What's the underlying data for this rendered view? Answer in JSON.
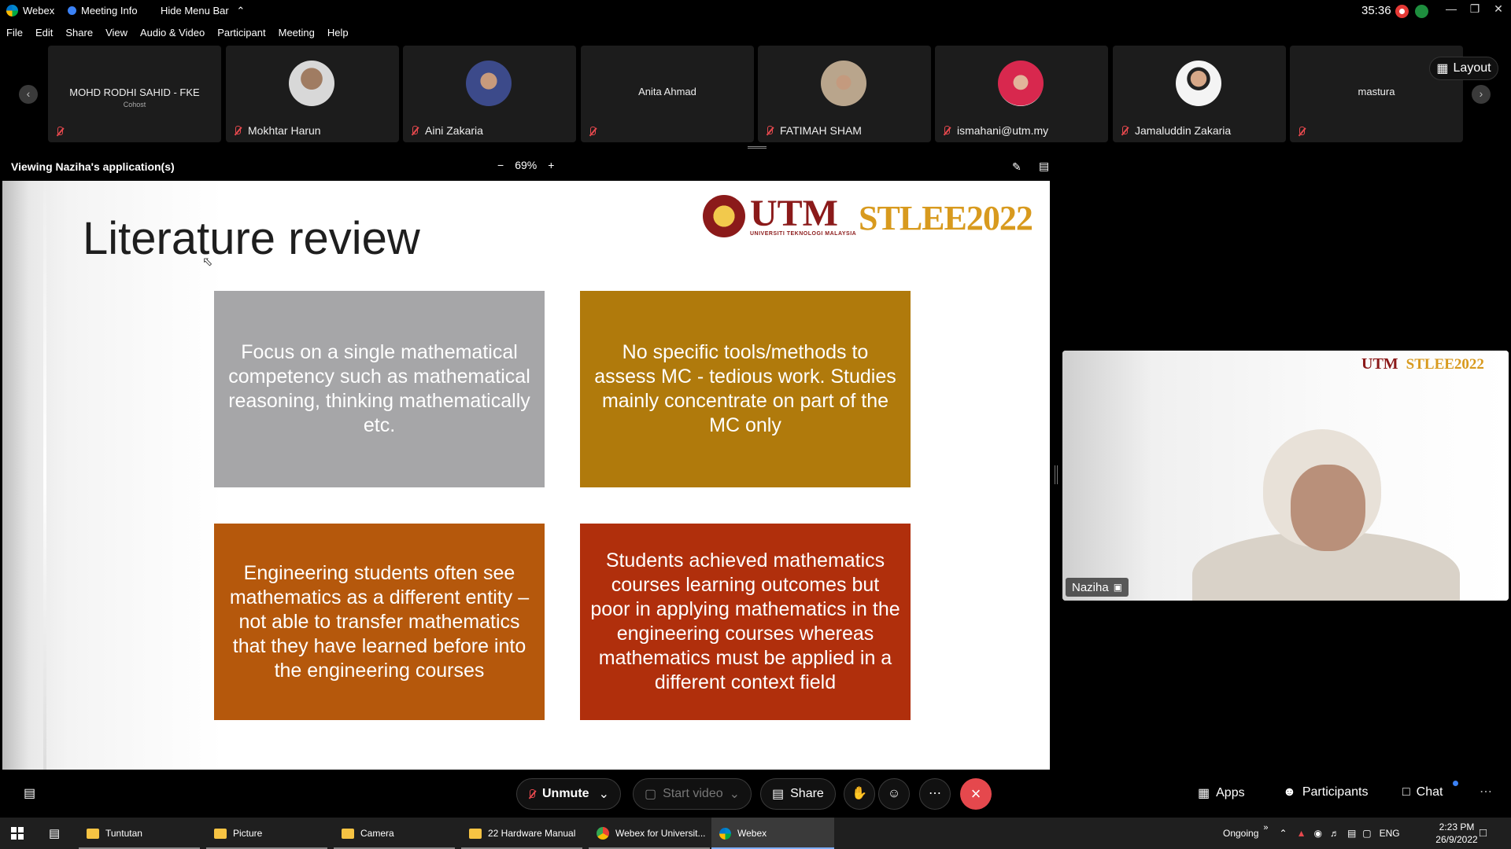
{
  "titlebar": {
    "app_name": "Webex",
    "meeting_info": "Meeting Info",
    "hide_menu": "Hide Menu Bar",
    "timer": "35:36"
  },
  "menu": [
    "File",
    "Edit",
    "Share",
    "View",
    "Audio & Video",
    "Participant",
    "Meeting",
    "Help"
  ],
  "participants": [
    {
      "name": "MOHD RODHI SAHID - FKE",
      "role": "Cohost"
    },
    {
      "name": "Mokhtar Harun"
    },
    {
      "name": "Aini Zakaria"
    },
    {
      "name": "Anita Ahmad"
    },
    {
      "name": "FATIMAH SHAM"
    },
    {
      "name": "ismahani@utm.my"
    },
    {
      "name": "Jamaluddin Zakaria"
    },
    {
      "name": "mastura"
    }
  ],
  "layout_label": "Layout",
  "share": {
    "viewing": "Viewing Naziha's application(s)",
    "zoom": "69%"
  },
  "slide": {
    "title": "Literature review",
    "utm": "UTM",
    "utm_sub": "UNIVERSITI TEKNOLOGI MALAYSIA",
    "conference": "STLEE2022",
    "boxes": [
      {
        "text": "Focus on a single mathematical competency such as mathematical reasoning, thinking mathematically etc.",
        "color": "#a6a6a8"
      },
      {
        "text": "No specific tools/methods to assess MC -  tedious work. Studies mainly concentrate on part of the MC only",
        "color": "#b07a0c"
      },
      {
        "text": "Engineering  students often see mathematics as a different entity – not able to transfer mathematics that they have learned before into the engineering courses",
        "color": "#b5580c"
      },
      {
        "text": "Students achieved mathematics courses learning outcomes but poor in applying mathematics in the engineering courses whereas mathematics must be applied in a different context field",
        "color": "#b02f0c"
      }
    ]
  },
  "self_video": {
    "name": "Naziha",
    "utm": "UTM",
    "conference": "STLEE2022"
  },
  "controls": {
    "unmute": "Unmute",
    "start_video": "Start video",
    "share": "Share",
    "apps": "Apps",
    "participants": "Participants",
    "chat": "Chat"
  },
  "taskbar": {
    "items": [
      "Tuntutan",
      "Picture",
      "Camera",
      "22 Hardware Manual",
      "Webex for Universit...",
      "Webex"
    ],
    "status": "Ongoing",
    "lang": "ENG",
    "time": "2:23 PM",
    "date": "26/9/2022"
  },
  "colors": {
    "end_call": "#e5484d",
    "mic_muted": "#e5484d",
    "accent": "#3b82f6"
  }
}
